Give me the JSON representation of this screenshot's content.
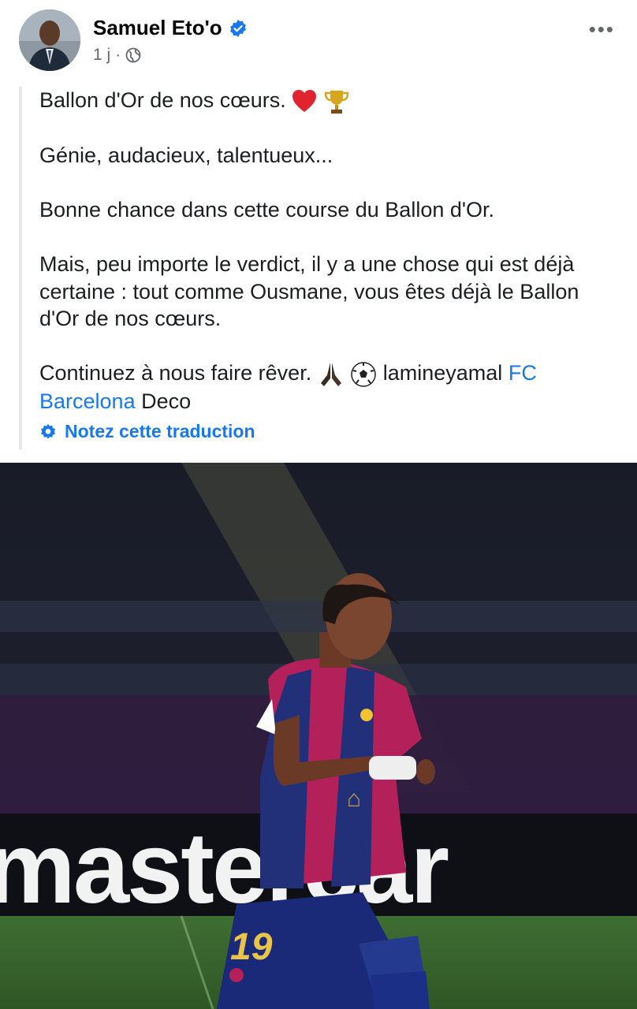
{
  "post": {
    "author": "Samuel Eto'o",
    "time": "1 j",
    "separator": "·",
    "more_label": "•••",
    "lines": {
      "p1": "Ballon d'Or de nos cœurs.",
      "p2": "Génie, audacieux, talentueux...",
      "p3": "Bonne chance dans cette course du Ballon d'Or.",
      "p4": "Mais, peu importe le verdict, il y a une chose qui est déjà certaine : tout comme Ousmane, vous êtes déjà le Ballon d'Or de nos cœurs.",
      "p5_start": "Continuez à nous faire rêver.",
      "tag_1": "lamineyamal",
      "tag_2": "FC Barcelona",
      "tag_3": "Deco"
    },
    "translate_label": "Notez cette traduction"
  },
  "photo": {
    "banner_text": "mastercar",
    "shirt_number": "19"
  },
  "colors": {
    "link": "#1877f2",
    "secondary_text": "#65676b",
    "verified": "#1877f2"
  },
  "icons": [
    "verified-badge-icon",
    "globe-icon",
    "more-options-icon",
    "heart-emoji-icon",
    "trophy-emoji-icon",
    "praying-hands-emoji-icon",
    "soccer-ball-emoji-icon",
    "gear-icon"
  ]
}
